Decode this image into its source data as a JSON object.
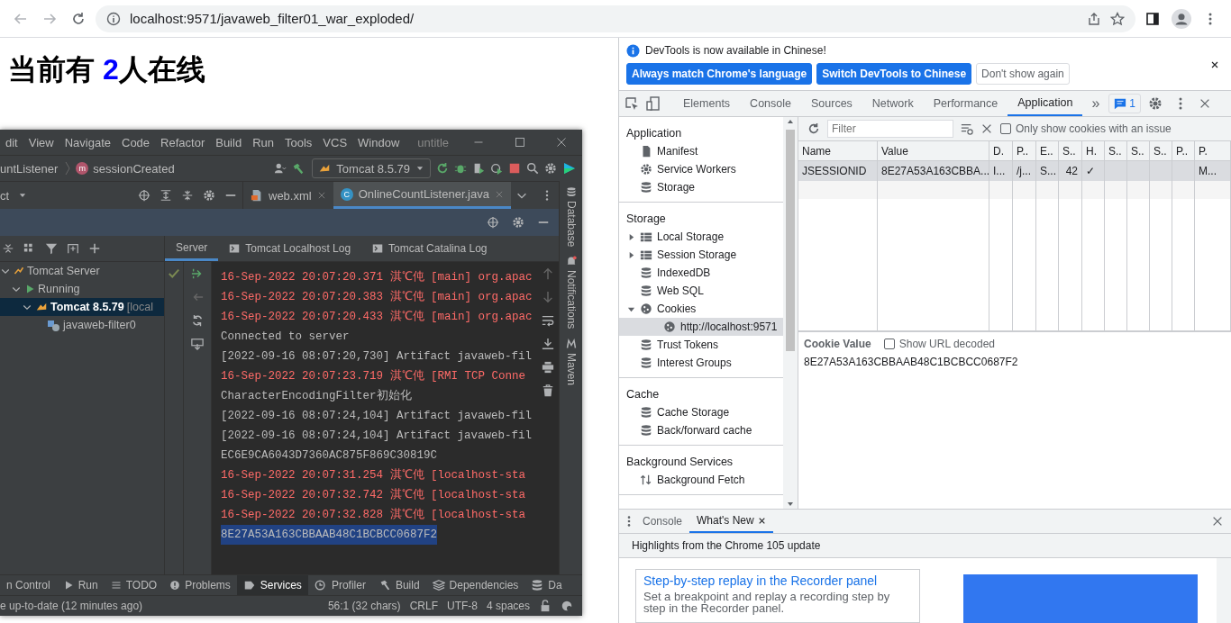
{
  "browser": {
    "url": "localhost:9571/javaweb_filter01_war_exploded/"
  },
  "page": {
    "heading_before": "当前有 ",
    "count": "2",
    "heading_after": "人在线"
  },
  "ide": {
    "menu": [
      "dit",
      "View",
      "Navigate",
      "Code",
      "Refactor",
      "Build",
      "Run",
      "Tools",
      "VCS",
      "Window"
    ],
    "title": "untitle",
    "breadcrumbs": [
      {
        "label": "untListener",
        "kind": "class"
      },
      {
        "label": "sessionCreated",
        "kind": "method",
        "badge": "m"
      }
    ],
    "run_config": "Tomcat 8.5.79",
    "project_label": "ct",
    "editor_tabs": [
      {
        "label": "web.xml",
        "kind": "xml",
        "selected": false
      },
      {
        "label": "OnlineCountListener.java",
        "kind": "class",
        "badge": "C",
        "selected": true
      }
    ],
    "services_tabs": [
      {
        "label": "Server",
        "selected": true
      },
      {
        "label": "Tomcat Localhost Log",
        "selected": false
      },
      {
        "label": "Tomcat Catalina Log",
        "selected": false
      }
    ],
    "tree": [
      {
        "label": "Tomcat Server",
        "kind": "server",
        "selected": false,
        "children": [
          {
            "label": "Running",
            "kind": "run",
            "selected": false,
            "children": [
              {
                "label": "Tomcat 8.5.79",
                "note": "[local",
                "kind": "tomcat",
                "selected": true,
                "children": [
                  {
                    "label": "javaweb-filter0",
                    "kind": "artifact",
                    "selected": false
                  }
                ]
              }
            ]
          }
        ]
      }
    ],
    "console": [
      {
        "text": "16-Sep-2022 20:07:20.371 淇℃伅 [main] org.apac",
        "kind": "error",
        "selected": false
      },
      {
        "text": "16-Sep-2022 20:07:20.383 淇℃伅 [main] org.apac",
        "kind": "error",
        "selected": false
      },
      {
        "text": "16-Sep-2022 20:07:20.433 淇℃伅 [main] org.apac",
        "kind": "error",
        "selected": false
      },
      {
        "text": "Connected to server",
        "kind": "info",
        "selected": false
      },
      {
        "text": "[2022-09-16 08:07:20,730] Artifact javaweb-fil",
        "kind": "info",
        "selected": false
      },
      {
        "text": "16-Sep-2022 20:07:23.719 淇℃伅 [RMI TCP Conne",
        "kind": "error",
        "selected": false
      },
      {
        "text": "CharacterEncodingFilter初始化",
        "kind": "info",
        "selected": false
      },
      {
        "text": "[2022-09-16 08:07:24,104] Artifact javaweb-fil",
        "kind": "info",
        "selected": false
      },
      {
        "text": "[2022-09-16 08:07:24,104] Artifact javaweb-fil",
        "kind": "info",
        "selected": false
      },
      {
        "text": "EC6E9CA6043D7360AC875F869C30819C",
        "kind": "info",
        "selected": false
      },
      {
        "text": "16-Sep-2022 20:07:31.254 淇℃伅 [localhost-sta",
        "kind": "error",
        "selected": false
      },
      {
        "text": "16-Sep-2022 20:07:32.742 淇℃伅 [localhost-sta",
        "kind": "error",
        "selected": false
      },
      {
        "text": "16-Sep-2022 20:07:32.828 淇℃伅 [localhost-sta",
        "kind": "error",
        "selected": false
      },
      {
        "text": "8E27A53A163CBBAAB48C1BCBCC0687F2",
        "kind": "info",
        "selected": true
      }
    ],
    "side_tools": [
      "Database",
      "Notifications",
      "Maven"
    ],
    "tool_windows": [
      {
        "label": "n Control",
        "kind": "none",
        "selected": false
      },
      {
        "label": "Run",
        "kind": "run",
        "selected": false
      },
      {
        "label": "TODO",
        "kind": "list",
        "selected": false
      },
      {
        "label": "Problems",
        "kind": "problem",
        "selected": false
      },
      {
        "label": "Services",
        "kind": "services",
        "selected": true
      },
      {
        "label": "Profiler",
        "kind": "profiler",
        "selected": false
      },
      {
        "label": "Build",
        "kind": "build",
        "selected": false
      },
      {
        "label": "Dependencies",
        "kind": "deps",
        "selected": false
      },
      {
        "label": "Da",
        "kind": "db",
        "selected": false
      }
    ],
    "status": {
      "message": "e up-to-date (12 minutes ago)",
      "items": [
        "56:1 (32 chars)",
        "CRLF",
        "UTF-8",
        "4 spaces"
      ]
    }
  },
  "devtools": {
    "banner": {
      "message": "DevTools is now available in Chinese!",
      "buttons": [
        {
          "label": "Always match Chrome's language",
          "kind": "primary"
        },
        {
          "label": "Switch DevTools to Chinese",
          "kind": "primary"
        },
        {
          "label": "Don't show again",
          "kind": "secondary"
        }
      ]
    },
    "tabs": [
      {
        "label": "Elements",
        "selected": false
      },
      {
        "label": "Console",
        "selected": false
      },
      {
        "label": "Sources",
        "selected": false
      },
      {
        "label": "Network",
        "selected": false
      },
      {
        "label": "Performance",
        "selected": false
      },
      {
        "label": "Application",
        "selected": true
      }
    ],
    "more": "»",
    "issues": "1",
    "sidebar": [
      {
        "title": "Application",
        "items": [
          {
            "label": "Manifest",
            "kind": "file",
            "selected": false
          },
          {
            "label": "Service Workers",
            "kind": "gear",
            "selected": false
          },
          {
            "label": "Storage",
            "kind": "db",
            "selected": false
          }
        ]
      },
      {
        "title": "Storage",
        "items": [
          {
            "label": "Local Storage",
            "kind": "grid",
            "selected": false,
            "expanded": false
          },
          {
            "label": "Session Storage",
            "kind": "grid",
            "selected": false,
            "expanded": false
          },
          {
            "label": "IndexedDB",
            "kind": "db",
            "selected": false
          },
          {
            "label": "Web SQL",
            "kind": "db",
            "selected": false
          },
          {
            "label": "Cookies",
            "kind": "cookie",
            "selected": false,
            "expanded": true,
            "children": [
              {
                "label": "http://localhost:9571",
                "kind": "cookie",
                "selected": true
              }
            ]
          },
          {
            "label": "Trust Tokens",
            "kind": "db",
            "selected": false
          },
          {
            "label": "Interest Groups",
            "kind": "db",
            "selected": false
          }
        ]
      },
      {
        "title": "Cache",
        "items": [
          {
            "label": "Cache Storage",
            "kind": "db",
            "selected": false
          },
          {
            "label": "Back/forward cache",
            "kind": "db",
            "selected": false
          }
        ]
      },
      {
        "title": "Background Services",
        "items": [
          {
            "label": "Background Fetch",
            "kind": "updown",
            "selected": false
          }
        ]
      }
    ],
    "cookies": {
      "filter_placeholder": "Filter",
      "issue_only": {
        "label": "Only show cookies with an issue",
        "checked": false
      },
      "columns": [
        "Name",
        "Value",
        "D.",
        "P..",
        "E..",
        "S..",
        "H.",
        "S..",
        "S..",
        "S..",
        "P..",
        "P."
      ],
      "rows": [
        {
          "cells": [
            "JSESSIONID",
            "8E27A53A163CBBA...",
            "I...",
            "/j...",
            "S...",
            "42",
            "✓",
            null,
            null,
            null,
            null,
            "M..."
          ],
          "selected": true
        }
      ]
    },
    "cookie_value": {
      "label": "Cookie Value",
      "decode": {
        "label": "Show URL decoded",
        "checked": false
      },
      "value": "8E27A53A163CBBAAB48C1BCBCC0687F2"
    },
    "drawer": {
      "tabs": [
        {
          "label": "Console",
          "selected": false,
          "closable": false
        },
        {
          "label": "What's New",
          "selected": true,
          "closable": true
        }
      ],
      "headline": "Highlights from the Chrome 105 update",
      "card": {
        "title": "Step-by-step replay in the Recorder panel",
        "body": "Set a breakpoint and replay a recording step by step in the Recorder panel."
      }
    }
  }
}
